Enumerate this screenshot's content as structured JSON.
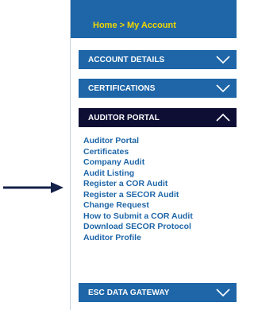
{
  "breadcrumb": {
    "home": "Home",
    "separator": ">",
    "current": "My Account"
  },
  "sections": {
    "account_details": {
      "label": "ACCOUNT DETAILS",
      "state": "collapsed"
    },
    "certifications": {
      "label": "CERTIFICATIONS",
      "state": "collapsed"
    },
    "auditor_portal": {
      "label": "AUDITOR PORTAL",
      "state": "expanded"
    },
    "esc_data_gateway": {
      "label": "ESC DATA GATEWAY",
      "state": "collapsed"
    }
  },
  "auditor_portal_links": [
    "Auditor Portal",
    "Certificates",
    "Company Audit",
    "Audit Listing",
    "Register a COR Audit",
    "Register a SECOR Audit",
    "Change Request",
    "How to Submit a COR Audit",
    "Download SECOR Protocol",
    "Auditor Profile"
  ],
  "pointer": {
    "target": "Audit Listing",
    "icon": "arrow-right-icon"
  },
  "colors": {
    "accent_blue": "#1e66a8",
    "active_dark": "#0e0e35",
    "breadcrumb_yellow": "#f2d600",
    "arrow_navy": "#14224a"
  }
}
